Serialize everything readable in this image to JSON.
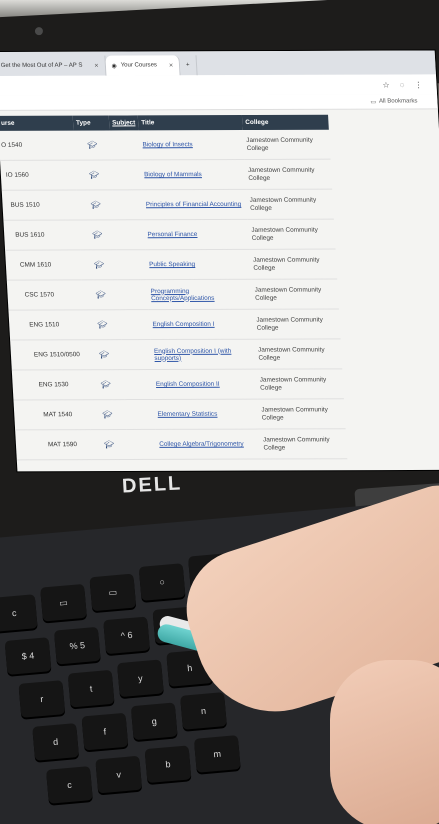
{
  "browser": {
    "tabs": [
      {
        "label": "Get the Most Out of AP – AP S",
        "close": "×"
      },
      {
        "label": "Your Courses",
        "close": "×"
      }
    ],
    "new_tab": "+",
    "bookmarks_label": "All Bookmarks"
  },
  "table": {
    "headers": {
      "course": "urse",
      "type": "Type",
      "subject": "Subject",
      "title": "Title",
      "college": "College"
    },
    "rows": [
      {
        "course": "O 1540",
        "title": "Biology of Insects",
        "college": "Jamestown Community College"
      },
      {
        "course": "IO 1560",
        "title": "Biology of Mammals",
        "college": "Jamestown Community College"
      },
      {
        "course": "BUS 1510",
        "title": "Principles of Financial Accounting",
        "college": "Jamestown Community College"
      },
      {
        "course": "BUS 1610",
        "title": "Personal Finance",
        "college": "Jamestown Community College"
      },
      {
        "course": "CMM 1610",
        "title": "Public Speaking",
        "college": "Jamestown Community College"
      },
      {
        "course": "CSC 1570",
        "title": "Programming Concepts/Applications",
        "college": "Jamestown Community College"
      },
      {
        "course": "ENG 1510",
        "title": "English Composition I",
        "college": "Jamestown Community College"
      },
      {
        "course": "ENG 1510/0500",
        "title": "English Composition I (with supports)",
        "college": "Jamestown Community College"
      },
      {
        "course": "ENG 1530",
        "title": "English Composition II",
        "college": "Jamestown Community College"
      },
      {
        "course": "MAT 1540",
        "title": "Elementary Statistics",
        "college": "Jamestown Community College"
      },
      {
        "course": "MAT 1590",
        "title": "College Algebra/Trigonometry",
        "college": "Jamestown Community College"
      }
    ]
  },
  "laptop_brand": "DELL",
  "icons": {
    "type": "graduation-cap-icon"
  }
}
